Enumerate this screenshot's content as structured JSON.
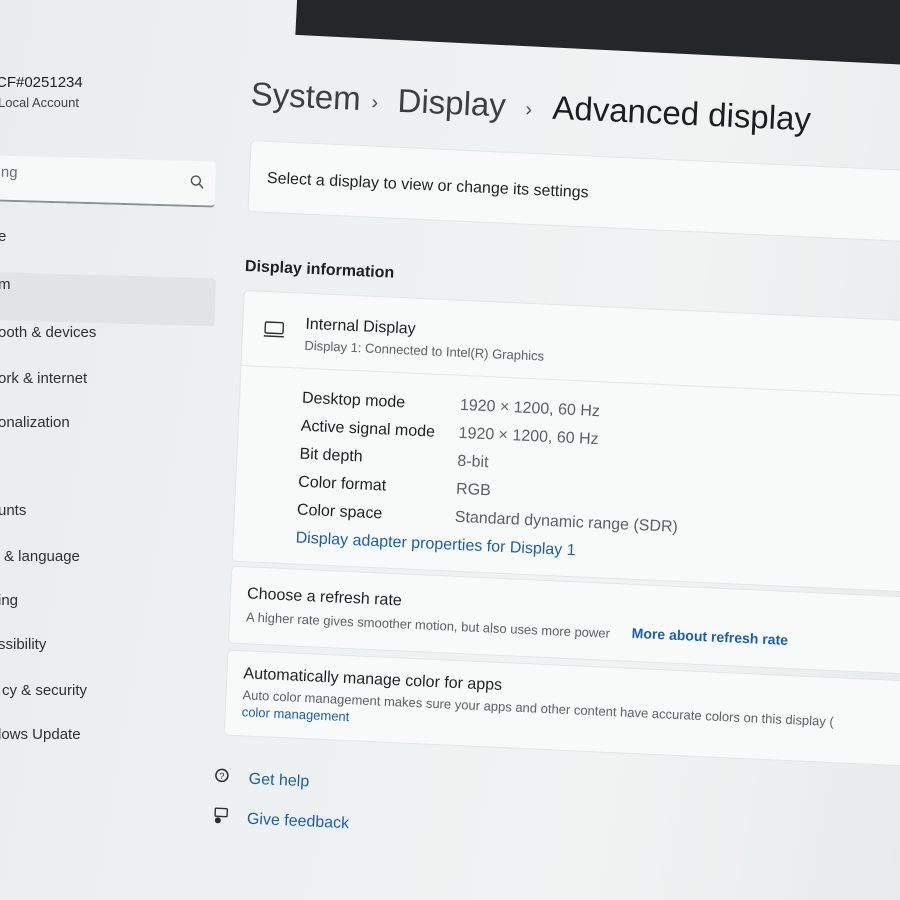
{
  "account": {
    "id": "CF#0251234",
    "type": "Local Account"
  },
  "search": {
    "placeholder": "ing"
  },
  "nav": [
    {
      "label": "e"
    },
    {
      "label": "m"
    },
    {
      "label": "ooth & devices"
    },
    {
      "label": "ork & internet"
    },
    {
      "label": "onalization"
    },
    {
      "label": "unts"
    },
    {
      "label": "& language"
    },
    {
      "label": "ing"
    },
    {
      "label": "ssibility"
    },
    {
      "label": "cy & security"
    },
    {
      "label": "lows Update"
    }
  ],
  "breadcrumb": {
    "part1": "System",
    "part2": "Display",
    "current": "Advanced display",
    "separator": "›"
  },
  "select_display": {
    "label": "Select a display to view or change its settings"
  },
  "display_info": {
    "heading": "Display information",
    "name": "Internal Display",
    "connection": "Display 1: Connected to Intel(R) Graphics",
    "rows": [
      {
        "label": "Desktop mode",
        "value": "1920 × 1200, 60 Hz"
      },
      {
        "label": "Active signal mode",
        "value": "1920 × 1200, 60 Hz"
      },
      {
        "label": "Bit depth",
        "value": "8-bit"
      },
      {
        "label": "Color format",
        "value": "RGB"
      },
      {
        "label": "Color space",
        "value": "Standard dynamic range (SDR)"
      }
    ],
    "adapter_link": "Display adapter properties for Display 1"
  },
  "refresh_rate": {
    "title": "Choose a refresh rate",
    "desc": "A higher rate gives smoother motion, but also uses more power",
    "link": "More about refresh rate"
  },
  "color_mgmt": {
    "title": "Automatically manage color for apps",
    "desc": "Auto color management makes sure your apps and other content have accurate colors on this display (",
    "link": "color management"
  },
  "help": {
    "get_help": "Get help",
    "feedback": "Give feedback"
  },
  "colors": {
    "accent": "#1b5fa8",
    "background": "#eef1f2"
  }
}
